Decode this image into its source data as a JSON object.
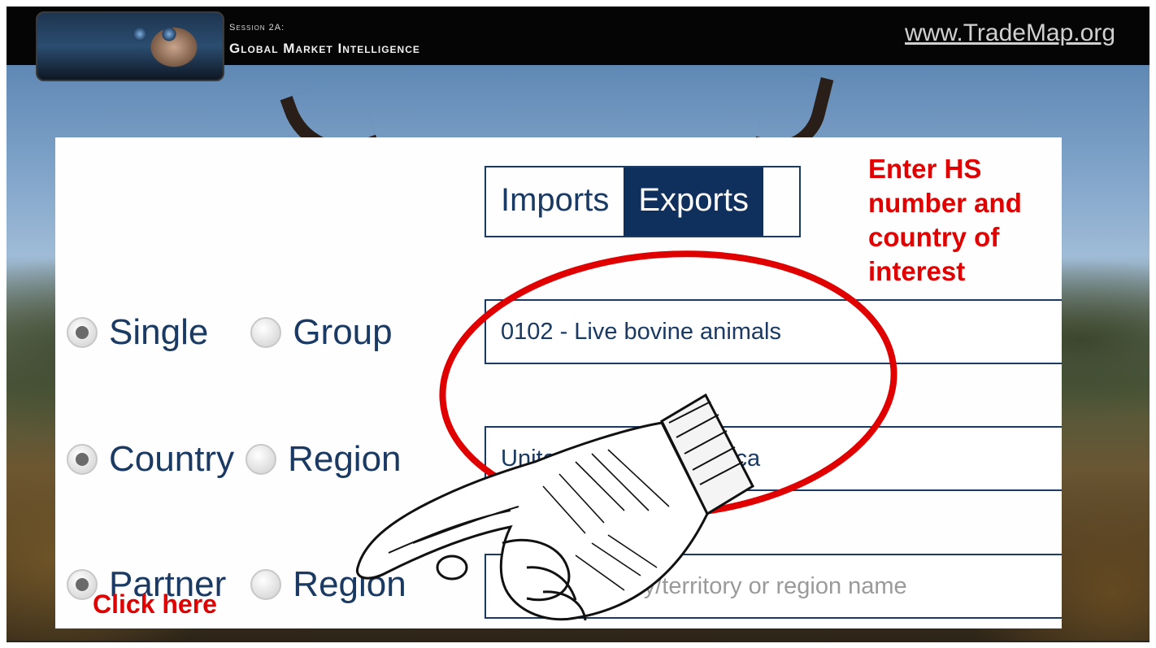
{
  "header": {
    "session_label": "Session 2A:",
    "session_title": "Global Market Intelligence",
    "site_link": "www.TradeMap.org"
  },
  "tabs": [
    {
      "label": "Imports",
      "active": false
    },
    {
      "label": "Exports",
      "active": true
    }
  ],
  "options": {
    "row1": {
      "left": {
        "label": "Single",
        "checked": true
      },
      "right": {
        "label": "Group",
        "checked": false
      }
    },
    "row2": {
      "left": {
        "label": "Country",
        "checked": true
      },
      "right": {
        "label": "Region",
        "checked": false
      }
    },
    "row3": {
      "left": {
        "label": "Partner",
        "checked": true
      },
      "right": {
        "label": "Region",
        "checked": false
      }
    }
  },
  "fields": {
    "product": {
      "value": "0102 - Live bovine animals"
    },
    "country": {
      "value": "United States of America"
    },
    "partner": {
      "placeholder": "Type a country/territory or region name"
    }
  },
  "annotations": {
    "enter_hs": "Enter HS number and country of interest",
    "click_here": "Click here"
  },
  "colors": {
    "navy": "#0f2f5c",
    "annotation_red": "#e00000"
  },
  "icons": {
    "pointing_hand": "pointing-hand-icon",
    "highlight_circle": "red-ellipse"
  }
}
